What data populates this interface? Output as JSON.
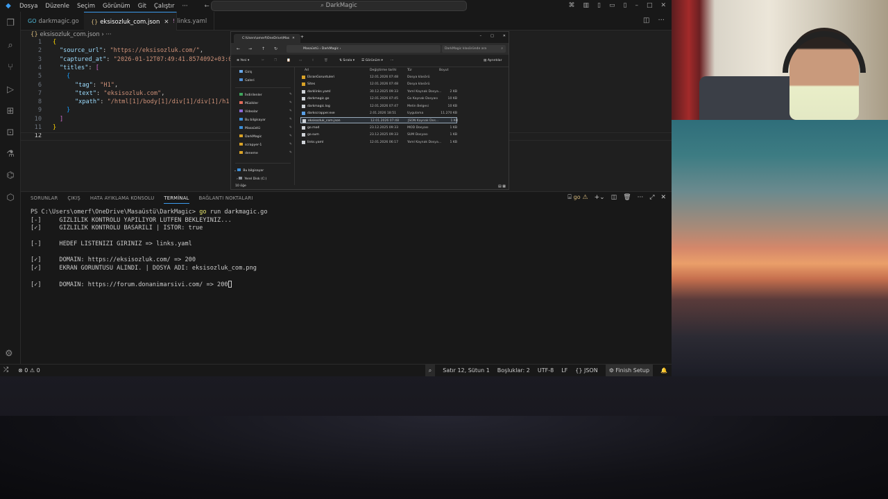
{
  "titlebar": {
    "menu": [
      "Dosya",
      "Düzenle",
      "Seçim",
      "Görünüm",
      "Git",
      "Çalıştır",
      "···"
    ],
    "search": "DarkMagic"
  },
  "tabs": [
    {
      "label": "darkmagic.go",
      "icon": "go-file-icon"
    },
    {
      "label": "eksisozluk_com.json",
      "icon": "json-file-icon",
      "active": true
    },
    {
      "label": "links.yaml",
      "icon": "yaml-file-icon"
    }
  ],
  "breadcrumb": "eksisozluk_com.json",
  "editor": {
    "line_numbers": [
      "1",
      "2",
      "3",
      "4",
      "5",
      "6",
      "7",
      "8",
      "9",
      "10",
      "11",
      "12"
    ],
    "lines": {
      "l1": "{",
      "l2_key": "\"source_url\"",
      "l2_val": "\"https://eksisozluk.com/\"",
      "l3_key": "\"captured_at\"",
      "l3_val": "\"2026-01-12T07:49:41.8574092+03:00",
      "l4_key": "\"titles\"",
      "l4_br": "[",
      "l5": "{",
      "l6_key": "\"tag\"",
      "l6_val": "\"H1\"",
      "l7_key": "\"text\"",
      "l7_val": "\"eksisozluk.com\"",
      "l8_key": "\"xpath\"",
      "l8_val": "\"/html[1]/body[1]/div[1]/div[1]/h1[1",
      "l9": "}",
      "l10": "]",
      "l11": "}"
    }
  },
  "explorer": {
    "tab_title": "C:\\Users\\omerf\\OneDrive\\Mas",
    "address": [
      "Masaüstü",
      "DarkMagic"
    ],
    "search_placeholder": "DarkMagic klasöründe ara",
    "cmd": {
      "new": "Yeni",
      "sort": "Sırala",
      "view": "Görünüm",
      "details": "Ayrıntılar"
    },
    "sidebar": [
      {
        "label": "Giriş"
      },
      {
        "label": "Galeri"
      },
      {
        "label": "İndirilenler"
      },
      {
        "label": "Müzikler"
      },
      {
        "label": "Videolar"
      },
      {
        "label": "Bu bilgisayar"
      },
      {
        "label": "Masaüstü"
      },
      {
        "label": "DarkMagic"
      },
      {
        "label": "scrapyer-1"
      },
      {
        "label": "deneme"
      },
      {
        "label": "Bu bilgisayar"
      },
      {
        "label": "Yerel Disk (C:)"
      }
    ],
    "columns": [
      "Ad",
      "Değiştirme tarihi",
      "Tür",
      "Boyut"
    ],
    "rows": [
      {
        "name": "EkranGoruntuleri",
        "date": "12.01.2026 07:48",
        "type": "Dosya klasörü",
        "size": "",
        "kind": "folder"
      },
      {
        "name": "Sites",
        "date": "12.01.2026 07:48",
        "type": "Dosya klasörü",
        "size": "",
        "kind": "folder"
      },
      {
        "name": "darklinks.yaml",
        "date": "30.12.2025 09:33",
        "type": "Yaml Kaynak Dosya...",
        "size": "2 KB",
        "kind": "file"
      },
      {
        "name": "darkmagic.go",
        "date": "12.01.2026 07:45",
        "type": "Go Kaynak Dosyası",
        "size": "10 KB",
        "kind": "file"
      },
      {
        "name": "darkmagic.log",
        "date": "12.01.2026 07:47",
        "type": "Metin Belgesi",
        "size": "10 KB",
        "kind": "file"
      },
      {
        "name": "darkscrapper.exe",
        "date": "2.01.2026 18:51",
        "type": "Uygulama",
        "size": "11.270 KB",
        "kind": "exe"
      },
      {
        "name": "eksisozluk_com.json",
        "date": "12.01.2026 07:48",
        "type": "JSON Kaynak Dos...",
        "size": "1 KB",
        "kind": "file",
        "selected": true
      },
      {
        "name": "go.mod",
        "date": "23.12.2025 09:33",
        "type": "MOD Dosyası",
        "size": "1 KB",
        "kind": "file"
      },
      {
        "name": "go.sum",
        "date": "23.12.2025 09:33",
        "type": "SUM Dosyası",
        "size": "1 KB",
        "kind": "file"
      },
      {
        "name": "links.yaml",
        "date": "12.01.2026 06:17",
        "type": "Yaml Kaynak Dosya...",
        "size": "1 KB",
        "kind": "file"
      }
    ],
    "status": "10 öğe"
  },
  "panel": {
    "tabs": [
      "SORUNLAR",
      "ÇIKIŞ",
      "HATA AYIKLAMA KONSOLU",
      "TERMİNAL",
      "BAĞLANTI NOKTALARI"
    ],
    "active_tab": "TERMİNAL",
    "terminal_profile": "go"
  },
  "terminal": {
    "prompt": "PS C:\\Users\\omerf\\OneDrive\\Masaüstü\\DarkMagic> ",
    "command_go": "go",
    "command_rest": " run darkmagic.go",
    "lines": [
      "[-]     GIZLILIK KONTROLU YAPILIYOR LUTFEN BEKLEYINIZ...",
      "[✓]     GIZLILIK KONTROLU BASARILI | ISTOR: true",
      "",
      "[-]     HEDEF LISTENIZI GIRINIZ => links.yaml",
      "",
      "[✓]     DOMAIN: https://eksisozluk.com/ => 200",
      "[✓]     EKRAN GORUNTUSU ALINDI. | DOSYA ADI: eksisozluk_com.png",
      "",
      "[✓]     DOMAIN: https://forum.donanimarsivi.com/ => 200"
    ]
  },
  "statusbar": {
    "errors": "0",
    "warnings": "0",
    "position": "Satır 12, Sütun 1",
    "spaces": "Boşluklar: 2",
    "encoding": "UTF-8",
    "eol": "LF",
    "language": "JSON",
    "finish": "Finish Setup"
  }
}
